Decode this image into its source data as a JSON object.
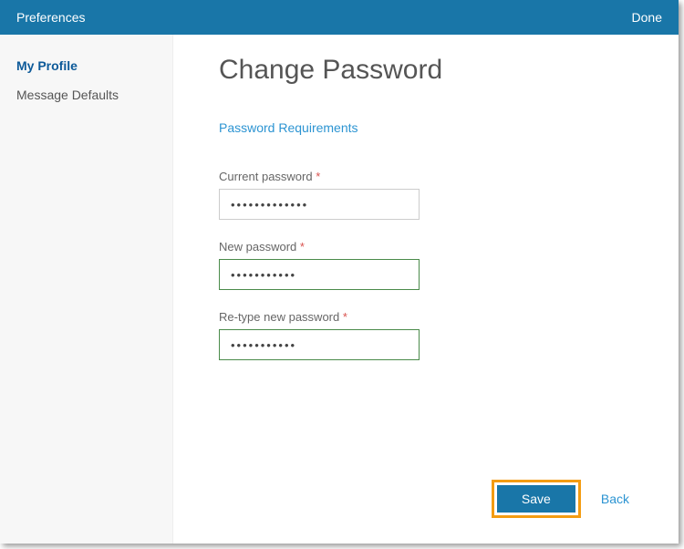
{
  "header": {
    "title": "Preferences",
    "done_label": "Done"
  },
  "sidebar": {
    "items": [
      {
        "label": "My Profile",
        "active": true
      },
      {
        "label": "Message Defaults",
        "active": false
      }
    ]
  },
  "main": {
    "title": "Change Password",
    "password_requirements_link": "Password Requirements",
    "fields": {
      "current": {
        "label": "Current password",
        "required": "*",
        "value": "•••••••••••••"
      },
      "new": {
        "label": "New password",
        "required": "*",
        "value": "•••••••••••"
      },
      "retype": {
        "label": "Re-type new password",
        "required": "*",
        "value": "•••••••••••"
      }
    }
  },
  "footer": {
    "save_label": "Save",
    "back_label": "Back"
  },
  "colors": {
    "primary": "#1976a8",
    "link": "#2c94d2",
    "highlight": "#f39c12",
    "valid_border": "#4a8b4a"
  }
}
